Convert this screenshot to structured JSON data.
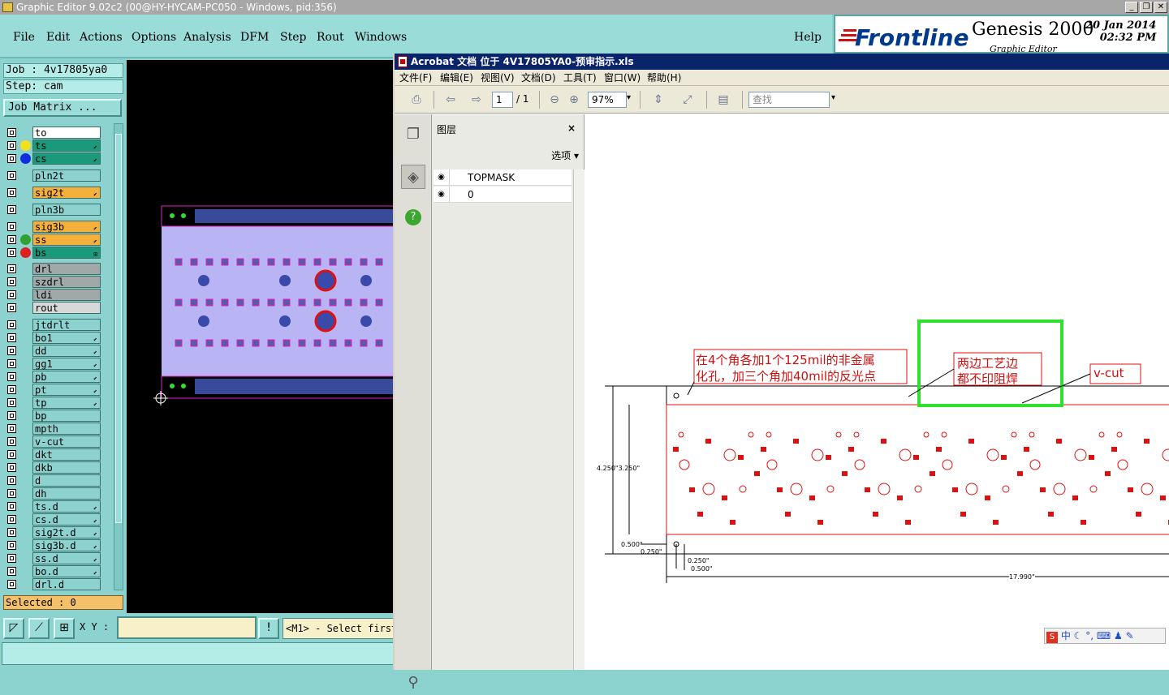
{
  "window": {
    "title": "Graphic Editor 9.02c2 (00@HY-HYCAM-PC050 - Windows, pid:356)",
    "controls": [
      "_",
      "❐",
      "✕"
    ]
  },
  "menubar": {
    "items": [
      "File",
      "Edit",
      "Actions",
      "Options",
      "Analysis",
      "DFM",
      "Step",
      "Rout",
      "Windows"
    ],
    "help": "Help"
  },
  "brand": {
    "logo": "Frontline",
    "product": "Genesis 2000",
    "subtitle": "Graphic Editor",
    "date": "20 Jan 2014",
    "time": "02:32 PM"
  },
  "job": {
    "job_label": "Job : 4v17805ya0",
    "step_label": "Step: cam",
    "matrix_button": "Job Matrix ..."
  },
  "layers": [
    {
      "name": "to",
      "color": "#ffffff",
      "dot": null,
      "mark": ""
    },
    {
      "name": "ts",
      "color": "#1a9a7a",
      "dot": "#f0e020",
      "mark": "⬋"
    },
    {
      "name": "cs",
      "color": "#1a9a7a",
      "dot": "#1030e0",
      "mark": "⬋"
    },
    {
      "name": "pln2t",
      "color": "#8cd3d0",
      "dot": null,
      "mark": ""
    },
    {
      "name": "sig2t",
      "color": "#f5b03c",
      "dot": null,
      "mark": "⬋"
    },
    {
      "name": "pln3b",
      "color": "#8cd3d0",
      "dot": null,
      "mark": ""
    },
    {
      "name": "sig3b",
      "color": "#f5b03c",
      "dot": null,
      "mark": "⬋"
    },
    {
      "name": "ss",
      "color": "#f5b03c",
      "dot": "#30a030",
      "mark": "⬋"
    },
    {
      "name": "bs",
      "color": "#1a9a7a",
      "dot": "#e02020",
      "mark": "⊞"
    },
    {
      "name": "drl",
      "color": "#a0a8a8",
      "dot": null,
      "mark": ""
    },
    {
      "name": "szdrl",
      "color": "#a0a8a8",
      "dot": null,
      "mark": ""
    },
    {
      "name": "ldi",
      "color": "#a0a8a8",
      "dot": null,
      "mark": ""
    },
    {
      "name": "rout",
      "color": "#d8d8d8",
      "dot": null,
      "mark": ""
    },
    {
      "name": "jtdrlt",
      "color": "#8cd3d0",
      "dot": null,
      "mark": ""
    },
    {
      "name": "bo1",
      "color": "#8cd3d0",
      "dot": null,
      "mark": "⬋"
    },
    {
      "name": "dd",
      "color": "#8cd3d0",
      "dot": null,
      "mark": "⬋"
    },
    {
      "name": "gg1",
      "color": "#8cd3d0",
      "dot": null,
      "mark": "⬋"
    },
    {
      "name": "pb",
      "color": "#8cd3d0",
      "dot": null,
      "mark": "⬋"
    },
    {
      "name": "pt",
      "color": "#8cd3d0",
      "dot": null,
      "mark": "⬋"
    },
    {
      "name": "tp",
      "color": "#8cd3d0",
      "dot": null,
      "mark": "⬋"
    },
    {
      "name": "bp",
      "color": "#8cd3d0",
      "dot": null,
      "mark": ""
    },
    {
      "name": "mpth",
      "color": "#8cd3d0",
      "dot": null,
      "mark": ""
    },
    {
      "name": "v-cut",
      "color": "#8cd3d0",
      "dot": null,
      "mark": ""
    },
    {
      "name": "dkt",
      "color": "#8cd3d0",
      "dot": null,
      "mark": ""
    },
    {
      "name": "dkb",
      "color": "#8cd3d0",
      "dot": null,
      "mark": ""
    },
    {
      "name": "d",
      "color": "#8cd3d0",
      "dot": null,
      "mark": ""
    },
    {
      "name": "dh",
      "color": "#8cd3d0",
      "dot": null,
      "mark": ""
    },
    {
      "name": "ts.d",
      "color": "#8cd3d0",
      "dot": null,
      "mark": "⬋"
    },
    {
      "name": "cs.d",
      "color": "#8cd3d0",
      "dot": null,
      "mark": "⬋"
    },
    {
      "name": "sig2t.d",
      "color": "#8cd3d0",
      "dot": null,
      "mark": "⬋"
    },
    {
      "name": "sig3b.d",
      "color": "#8cd3d0",
      "dot": null,
      "mark": "⬋"
    },
    {
      "name": "ss.d",
      "color": "#8cd3d0",
      "dot": null,
      "mark": "⬋"
    },
    {
      "name": "bo.d",
      "color": "#8cd3d0",
      "dot": null,
      "mark": "⬋"
    },
    {
      "name": "drl.d",
      "color": "#8cd3d0",
      "dot": null,
      "mark": ""
    }
  ],
  "status": {
    "selected": "Selected : 0"
  },
  "bottom": {
    "xy_label": "X Y :",
    "xy_value": "",
    "message": "<M1> - Select first"
  },
  "acrobat": {
    "title": "Acrobat 文档 位于 4V17805YA0-预审指示.xls",
    "menu": [
      "文件(F)",
      "编辑(E)",
      "视图(V)",
      "文档(D)",
      "工具(T)",
      "窗口(W)",
      "帮助(H)"
    ],
    "page_current": "1",
    "page_total": "/ 1",
    "zoom": "97%",
    "search_placeholder": "查找",
    "panel_title": "图层",
    "panel_close": "×",
    "panel_options": "选项 ▾",
    "panel_layers": [
      "TOPMASK",
      "0"
    ]
  },
  "drawing": {
    "note1_line1": "在4个角各加1个125mil的非金属",
    "note1_line2": "化孔，加三个角加40mil的反光点",
    "note2_line1": "两边工艺边",
    "note2_line2": "都不印阻焊",
    "note3": "v-cut",
    "dim_height": "4.250\"3.250\"",
    "dim_500a": "0.500\"",
    "dim_250a": "0.250\"",
    "dim_250b": "0.250\"",
    "dim_500b": "0.500\"",
    "dim_width": "17.990\""
  },
  "ime": {
    "label": "中"
  }
}
